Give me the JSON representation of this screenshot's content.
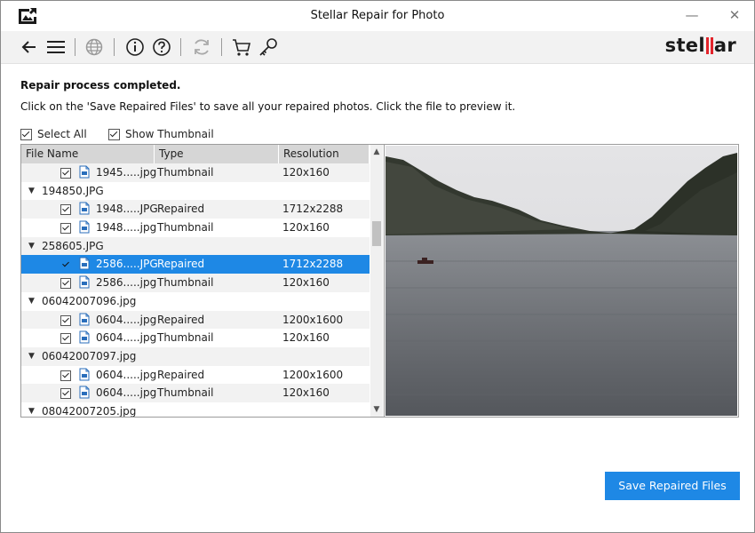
{
  "window": {
    "title": "Stellar Repair for Photo",
    "minimize_label": "—",
    "close_label": "✕"
  },
  "toolbar": {
    "icons": [
      "back-arrow-icon",
      "menu-icon",
      "globe-icon",
      "info-icon",
      "help-icon",
      "refresh-icon",
      "cart-icon",
      "key-icon"
    ],
    "brand_left": "stel",
    "brand_right": "ar"
  },
  "messages": {
    "status": "Repair process completed.",
    "instruction": "Click on the 'Save Repaired Files' to save all your repaired photos. Click the file to preview it."
  },
  "options": {
    "select_all": "Select All",
    "show_thumbnail": "Show Thumbnail"
  },
  "table": {
    "columns": [
      "File Name",
      "Type",
      "Resolution"
    ],
    "rows": [
      {
        "kind": "file",
        "name": "1945.....jpg",
        "type": "Thumbnail",
        "res": "120x160"
      },
      {
        "kind": "group",
        "name": "194850.JPG"
      },
      {
        "kind": "file",
        "name": "1948.....JPG",
        "type": "Repaired",
        "res": "1712x2288"
      },
      {
        "kind": "file",
        "name": "1948.....jpg",
        "type": "Thumbnail",
        "res": "120x160"
      },
      {
        "kind": "group",
        "name": "258605.JPG"
      },
      {
        "kind": "file",
        "name": "2586.....JPG",
        "type": "Repaired",
        "res": "1712x2288",
        "selected": true
      },
      {
        "kind": "file",
        "name": "2586.....jpg",
        "type": "Thumbnail",
        "res": "120x160"
      },
      {
        "kind": "group",
        "name": "06042007096.jpg"
      },
      {
        "kind": "file",
        "name": "0604.....jpg",
        "type": "Repaired",
        "res": "1200x1600"
      },
      {
        "kind": "file",
        "name": "0604.....jpg",
        "type": "Thumbnail",
        "res": "120x160"
      },
      {
        "kind": "group",
        "name": "06042007097.jpg"
      },
      {
        "kind": "file",
        "name": "0604.....jpg",
        "type": "Repaired",
        "res": "1200x1600"
      },
      {
        "kind": "file",
        "name": "0604.....jpg",
        "type": "Thumbnail",
        "res": "120x160"
      },
      {
        "kind": "group",
        "name": "08042007205.jpg"
      }
    ]
  },
  "actions": {
    "save_label": "Save Repaired Files"
  },
  "colors": {
    "accent": "#1e88e5",
    "brand_red": "#e3242b"
  }
}
